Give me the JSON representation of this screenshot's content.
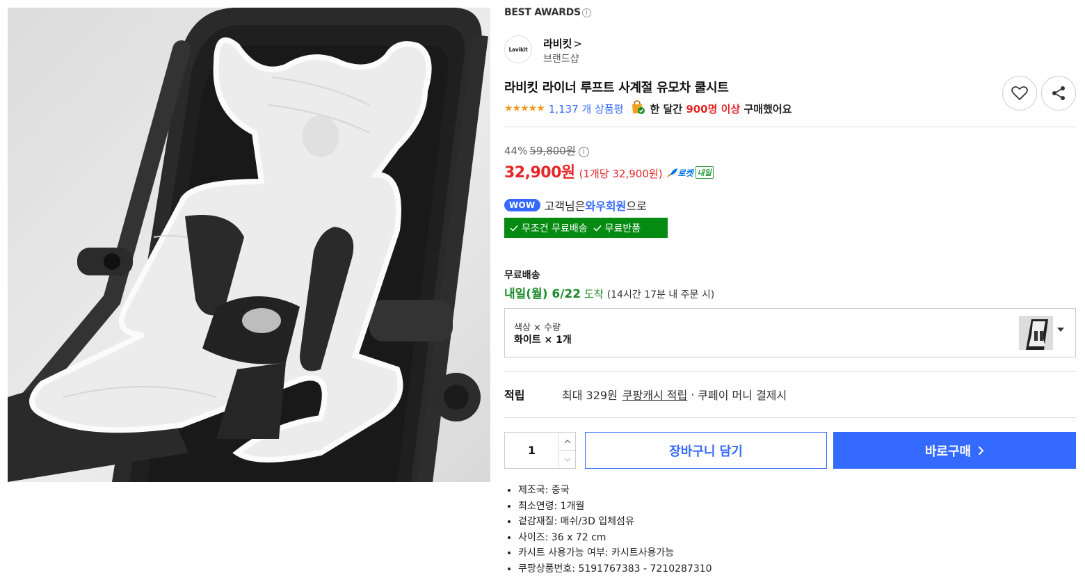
{
  "header": {
    "awards_label": "BEST AWARDS",
    "awards_info_glyph": "i"
  },
  "brand": {
    "logo_text": "Lavikit",
    "name": "라비킷",
    "chevron": ">",
    "sub": "브랜드샵"
  },
  "product": {
    "title": "라비킷 라이너 루프트 사계절 유모차 쿨시트",
    "star_glyphs": "★★★★★",
    "rating": 5,
    "review_count": "1,137 개 상품평",
    "purchase_prefix": "한 달간 ",
    "purchase_highlight": "900명 이상",
    "purchase_suffix": " 구매했어요",
    "icons": {
      "wishlist": "heart-icon",
      "share": "share-icon",
      "purchase": "shopping-bag-icon"
    }
  },
  "price": {
    "discount_rate": "44%",
    "original": "59,800원",
    "info_glyph": "i",
    "current": "32,900원",
    "unit_price": "(1개당 32,900원)",
    "rocket_label": "로켓",
    "rocket_tomorrow": "내일"
  },
  "membership": {
    "badge": "WOW",
    "text_prefix": "고객님은 ",
    "text_highlight": "와우회원",
    "text_suffix": "으로",
    "benefit_1": "무조건 무료배송",
    "benefit_2": "무료반품"
  },
  "shipping": {
    "label": "무료배송",
    "arrival_date": "내일(월) 6/22",
    "arrival_word": "도착",
    "cutoff": "(14시간 17분 내 주문 시)"
  },
  "option": {
    "label": "색상 × 수량",
    "value": "화이트 × 1개"
  },
  "points": {
    "label": "적립",
    "amount_text": "최대 329원",
    "link_text": "쿠팡캐시 적립",
    "separator": "·",
    "suffix": "쿠페이 머니 결제시"
  },
  "purchase": {
    "quantity": "1",
    "cart_label": "장바구니 담기",
    "buy_label": "바로구매",
    "buy_arrow": ">"
  },
  "specs": [
    "제조국: 중국",
    "최소연령: 1개월",
    "겉감재질: 매쉬/3D 입체섬유",
    "사이즈: 36 x 72 cm",
    "카시트 사용가능 여부: 카시트사용가능",
    "쿠팡상품번호: 5191767383 - 7210287310"
  ],
  "colors": {
    "accent_blue": "#346aff",
    "price_red": "#e52528",
    "free_green": "#058a12",
    "arrival_green": "#1b8a2a",
    "star_orange": "#f59a23"
  }
}
